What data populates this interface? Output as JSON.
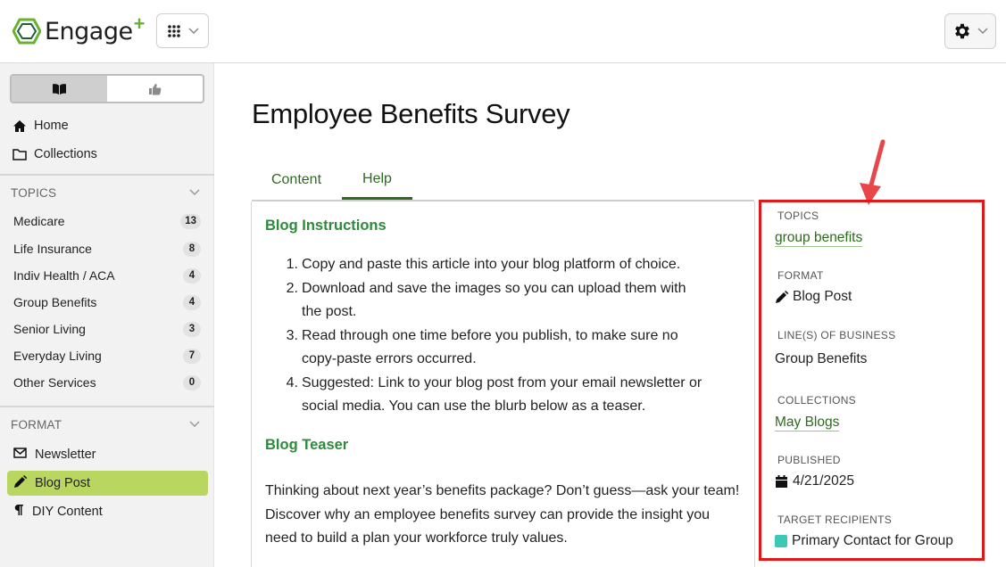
{
  "header": {
    "logo_text": "Engage",
    "logo_plus": "+",
    "apps_icon": "grid-icon",
    "settings_icon": "gear-icon"
  },
  "sidebar": {
    "nav": [
      {
        "label": "Home",
        "icon": "home-icon"
      },
      {
        "label": "Collections",
        "icon": "folder-icon"
      }
    ],
    "topics_heading": "TOPICS",
    "topics": [
      {
        "label": "Medicare",
        "count": "13"
      },
      {
        "label": "Life Insurance",
        "count": "8"
      },
      {
        "label": "Indiv Health / ACA",
        "count": "4"
      },
      {
        "label": "Group Benefits",
        "count": "4"
      },
      {
        "label": "Senior Living",
        "count": "3"
      },
      {
        "label": "Everyday Living",
        "count": "7"
      },
      {
        "label": "Other Services",
        "count": "0"
      }
    ],
    "format_heading": "FORMAT",
    "formats": [
      {
        "label": "Newsletter",
        "icon": "envelope-icon"
      },
      {
        "label": "Blog Post",
        "icon": "pencil-icon",
        "active": true
      },
      {
        "label": "DIY Content",
        "icon": "paragraph-icon"
      }
    ]
  },
  "main": {
    "title": "Employee Benefits Survey",
    "tabs": [
      {
        "label": "Content"
      },
      {
        "label": "Help",
        "active": true
      }
    ],
    "instructions_heading": "Blog Instructions",
    "instructions": [
      {
        "num": "1.",
        "lines": [
          "Copy and paste this article into your blog platform of choice."
        ]
      },
      {
        "num": "2.",
        "lines": [
          "Download and save the images so you can upload them with",
          "the post."
        ]
      },
      {
        "num": "3.",
        "lines": [
          "Read through one time before you publish, to make sure no",
          "copy-paste errors occurred."
        ]
      },
      {
        "num": "4.",
        "lines": [
          "Suggested: Link to your blog post from your email newsletter or",
          "social media. You can use the blurb below as a teaser."
        ]
      }
    ],
    "teaser_heading": "Blog Teaser",
    "teaser_lines": [
      "Thinking about next year’s benefits package? Don’t guess—ask your team!",
      "Discover why an employee benefits survey can provide the insight you",
      "need to build a plan your workforce truly values."
    ]
  },
  "meta": {
    "topics_label": "TOPICS",
    "topics_value": "group benefits",
    "format_label": "FORMAT",
    "format_value": "Blog Post",
    "lob_label": "LINE(S) OF BUSINESS",
    "lob_value": "Group Benefits",
    "collections_label": "COLLECTIONS",
    "collections_value": "May Blogs",
    "published_label": "PUBLISHED",
    "published_value": "4/21/2025",
    "recipients_label": "TARGET RECIPIENTS",
    "recipients_value": "Primary Contact for Group",
    "recipients_color": "#3cc9b4"
  },
  "colors": {
    "brand_green": "#67b32e",
    "link_green": "#2d6a1e",
    "heading_green": "#2d8a3a",
    "active_format": "#b9d660",
    "annotation_red": "#e01818"
  }
}
